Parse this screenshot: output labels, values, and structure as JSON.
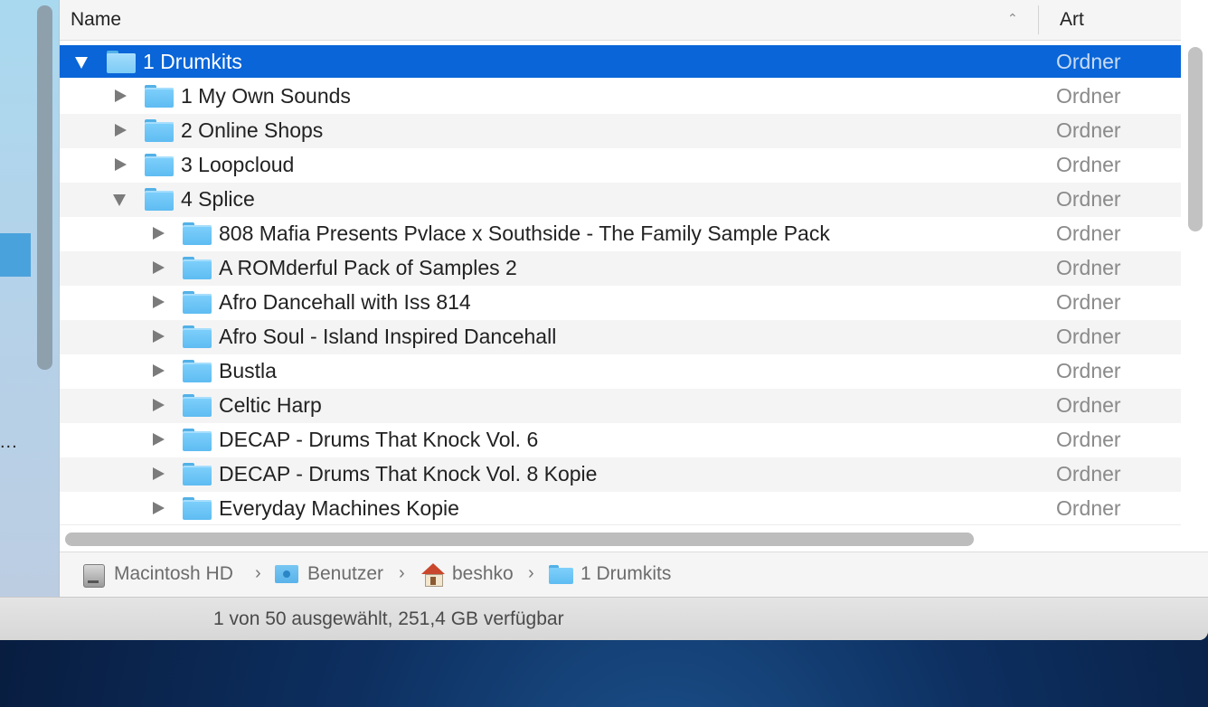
{
  "columns": {
    "name": "Name",
    "kind": "Art",
    "sort_indicator": "^"
  },
  "rows": [
    {
      "name": "1 Drumkits",
      "kind": "Ordner",
      "level": 0,
      "expanded": true,
      "selected": true
    },
    {
      "name": "1 My Own Sounds",
      "kind": "Ordner",
      "level": 1,
      "expanded": false
    },
    {
      "name": "2 Online Shops",
      "kind": "Ordner",
      "level": 1,
      "expanded": false
    },
    {
      "name": "3 Loopcloud",
      "kind": "Ordner",
      "level": 1,
      "expanded": false
    },
    {
      "name": "4 Splice",
      "kind": "Ordner",
      "level": 1,
      "expanded": true
    },
    {
      "name": "808 Mafia Presents Pvlace x Southside - The Family Sample Pack",
      "kind": "Ordner",
      "level": 2,
      "expanded": false
    },
    {
      "name": "A ROMderful Pack of Samples 2",
      "kind": "Ordner",
      "level": 2,
      "expanded": false
    },
    {
      "name": "Afro Dancehall with Iss 814",
      "kind": "Ordner",
      "level": 2,
      "expanded": false
    },
    {
      "name": "Afro Soul - Island Inspired Dancehall",
      "kind": "Ordner",
      "level": 2,
      "expanded": false
    },
    {
      "name": "Bustla",
      "kind": "Ordner",
      "level": 2,
      "expanded": false
    },
    {
      "name": "Celtic Harp",
      "kind": "Ordner",
      "level": 2,
      "expanded": false
    },
    {
      "name": "DECAP - Drums That Knock Vol. 6",
      "kind": "Ordner",
      "level": 2,
      "expanded": false
    },
    {
      "name": "DECAP - Drums That Knock Vol. 8 Kopie",
      "kind": "Ordner",
      "level": 2,
      "expanded": false
    },
    {
      "name": "Everyday Machines Kopie",
      "kind": "Ordner",
      "level": 2,
      "expanded": false
    }
  ],
  "path": {
    "items": [
      "Macintosh HD",
      "Benutzer",
      "beshko",
      "1 Drumkits"
    ],
    "separator": "›",
    "icons": [
      "hard-drive-icon",
      "users-folder-icon",
      "home-icon",
      "folder-icon"
    ]
  },
  "status": "1 von 50 ausgewählt, 251,4 GB verfügbar",
  "sidebar": {
    "overflow": "..."
  },
  "colors": {
    "selection": "#0965d8",
    "folder": "#6cc4f6",
    "kind_text": "#8a8a8a"
  }
}
